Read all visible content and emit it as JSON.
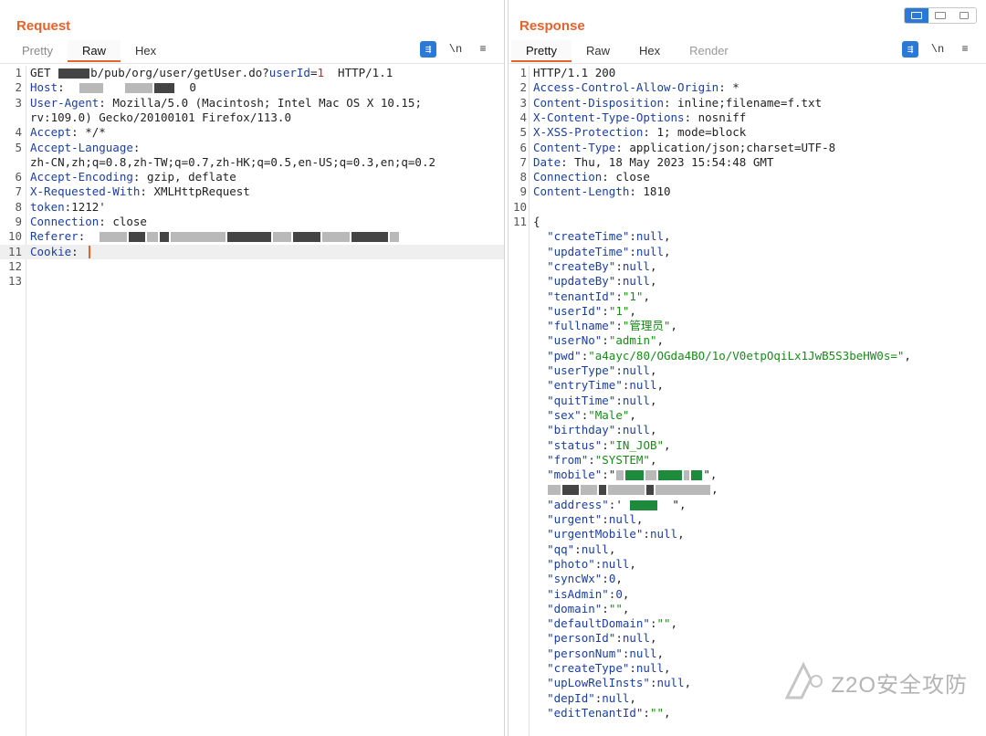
{
  "request": {
    "title": "Request",
    "tabs": [
      "Pretty",
      "Raw",
      "Hex"
    ],
    "active_tab": "Raw",
    "tools": {
      "wrap": "\\n",
      "menu": "≡"
    },
    "lines": [
      {
        "n": "1",
        "parts": [
          [
            "t",
            "GET "
          ],
          [
            "blurd",
            "34"
          ],
          [
            "t",
            "b/pub/org/user/getUser.do?"
          ],
          [
            "k",
            "userId"
          ],
          [
            "t",
            "="
          ],
          [
            "red",
            "1"
          ],
          [
            "t",
            "  HTTP/1.1"
          ]
        ]
      },
      {
        "n": "2",
        "parts": [
          [
            "k",
            "Host"
          ],
          [
            "t",
            ":  "
          ],
          [
            "blur",
            "26"
          ],
          [
            "t",
            "   "
          ],
          [
            "blur",
            "30"
          ],
          [
            "blurd",
            "22"
          ],
          [
            "t",
            "  0"
          ]
        ]
      },
      {
        "n": "3",
        "parts": [
          [
            "k",
            "User-Agent"
          ],
          [
            "t",
            ": Mozilla/5.0 (Macintosh; Intel Mac OS X 10.15;"
          ]
        ]
      },
      {
        "n": "",
        "parts": [
          [
            "t",
            "rv:109.0) Gecko/20100101 Firefox/113.0"
          ]
        ]
      },
      {
        "n": "4",
        "parts": [
          [
            "k",
            "Accept"
          ],
          [
            "t",
            ": */*"
          ]
        ]
      },
      {
        "n": "5",
        "parts": [
          [
            "k",
            "Accept-Language"
          ],
          [
            "t",
            ":"
          ]
        ]
      },
      {
        "n": "",
        "parts": [
          [
            "t",
            "zh-CN,zh;q=0.8,zh-TW;q=0.7,zh-HK;q=0.5,en-US;q=0.3,en;q=0.2"
          ]
        ]
      },
      {
        "n": "6",
        "parts": [
          [
            "k",
            "Accept-Encoding"
          ],
          [
            "t",
            ": gzip, deflate"
          ]
        ]
      },
      {
        "n": "7",
        "parts": [
          [
            "k",
            "X-Requested-With"
          ],
          [
            "t",
            ": XMLHttpRequest"
          ]
        ]
      },
      {
        "n": "8",
        "parts": [
          [
            "k",
            "token"
          ],
          [
            "t",
            ":1212'"
          ]
        ]
      },
      {
        "n": "9",
        "parts": [
          [
            "k",
            "Connection"
          ],
          [
            "t",
            ": close"
          ]
        ]
      },
      {
        "n": "10",
        "parts": [
          [
            "k",
            "Referer"
          ],
          [
            "t",
            ":  "
          ],
          [
            "blur",
            "30"
          ],
          [
            "blurd",
            "18"
          ],
          [
            "blur",
            "12"
          ],
          [
            "blurd",
            "10"
          ],
          [
            "blur",
            "60"
          ],
          [
            "blurd",
            "48"
          ],
          [
            "blur",
            "20"
          ],
          [
            "blurd",
            "30"
          ],
          [
            "blur",
            "30"
          ],
          [
            "blurd",
            "40"
          ],
          [
            "blur",
            "10"
          ]
        ]
      },
      {
        "n": "11",
        "parts": [
          [
            "k",
            "Cookie"
          ],
          [
            "t",
            ": "
          ],
          [
            "caret",
            ""
          ]
        ],
        "highlight": true
      },
      {
        "n": "12",
        "parts": []
      },
      {
        "n": "13",
        "parts": []
      }
    ]
  },
  "response": {
    "title": "Response",
    "tabs": [
      "Pretty",
      "Raw",
      "Hex",
      "Render"
    ],
    "active_tab": "Pretty",
    "tools": {
      "wrap": "\\n",
      "menu": "≡"
    },
    "lines": [
      {
        "n": "1",
        "parts": [
          [
            "t",
            "HTTP/1.1 200"
          ]
        ]
      },
      {
        "n": "2",
        "parts": [
          [
            "k",
            "Access-Control-Allow-Origin"
          ],
          [
            "t",
            ": *"
          ]
        ]
      },
      {
        "n": "3",
        "parts": [
          [
            "k",
            "Content-Disposition"
          ],
          [
            "t",
            ": inline;filename=f.txt"
          ]
        ]
      },
      {
        "n": "4",
        "parts": [
          [
            "k",
            "X-Content-Type-Options"
          ],
          [
            "t",
            ": nosniff"
          ]
        ]
      },
      {
        "n": "5",
        "parts": [
          [
            "k",
            "X-XSS-Protection"
          ],
          [
            "t",
            ": 1; mode=block"
          ]
        ]
      },
      {
        "n": "6",
        "parts": [
          [
            "k",
            "Content-Type"
          ],
          [
            "t",
            ": application/json;charset=UTF-8"
          ]
        ]
      },
      {
        "n": "7",
        "parts": [
          [
            "k",
            "Date"
          ],
          [
            "t",
            ": Thu, 18 May 2023 15:54:48 GMT"
          ]
        ]
      },
      {
        "n": "8",
        "parts": [
          [
            "k",
            "Connection"
          ],
          [
            "t",
            ": close"
          ]
        ]
      },
      {
        "n": "9",
        "parts": [
          [
            "k",
            "Content-Length"
          ],
          [
            "t",
            ": 1810"
          ]
        ]
      },
      {
        "n": "10",
        "parts": []
      },
      {
        "n": "11",
        "parts": [
          [
            "t",
            "{"
          ]
        ]
      },
      {
        "n": "",
        "parts": [
          [
            "t",
            "  "
          ],
          [
            "k",
            "\"createTime\""
          ],
          [
            "t",
            ":"
          ],
          [
            "v",
            "null"
          ],
          [
            "t",
            ","
          ]
        ]
      },
      {
        "n": "",
        "parts": [
          [
            "t",
            "  "
          ],
          [
            "k",
            "\"updateTime\""
          ],
          [
            "t",
            ":"
          ],
          [
            "v",
            "null"
          ],
          [
            "t",
            ","
          ]
        ]
      },
      {
        "n": "",
        "parts": [
          [
            "t",
            "  "
          ],
          [
            "k",
            "\"createBy\""
          ],
          [
            "t",
            ":"
          ],
          [
            "v",
            "null"
          ],
          [
            "t",
            ","
          ]
        ]
      },
      {
        "n": "",
        "parts": [
          [
            "t",
            "  "
          ],
          [
            "k",
            "\"updateBy\""
          ],
          [
            "t",
            ":"
          ],
          [
            "v",
            "null"
          ],
          [
            "t",
            ","
          ]
        ]
      },
      {
        "n": "",
        "parts": [
          [
            "t",
            "  "
          ],
          [
            "k",
            "\"tenantId\""
          ],
          [
            "t",
            ":"
          ],
          [
            "s",
            "\"1\""
          ],
          [
            "t",
            ","
          ]
        ]
      },
      {
        "n": "",
        "parts": [
          [
            "t",
            "  "
          ],
          [
            "k",
            "\"userId\""
          ],
          [
            "t",
            ":"
          ],
          [
            "s",
            "\"1\""
          ],
          [
            "t",
            ","
          ]
        ]
      },
      {
        "n": "",
        "parts": [
          [
            "t",
            "  "
          ],
          [
            "k",
            "\"fullname\""
          ],
          [
            "t",
            ":"
          ],
          [
            "s",
            "\"管理员\""
          ],
          [
            "t",
            ","
          ]
        ]
      },
      {
        "n": "",
        "parts": [
          [
            "t",
            "  "
          ],
          [
            "k",
            "\"userNo\""
          ],
          [
            "t",
            ":"
          ],
          [
            "s",
            "\"admin\""
          ],
          [
            "t",
            ","
          ]
        ]
      },
      {
        "n": "",
        "parts": [
          [
            "t",
            "  "
          ],
          [
            "k",
            "\"pwd\""
          ],
          [
            "t",
            ":"
          ],
          [
            "s",
            "\"a4ayc/80/OGda4BO/1o/V0etpOqiLx1JwB5S3beHW0s=\""
          ],
          [
            "t",
            ","
          ]
        ]
      },
      {
        "n": "",
        "parts": [
          [
            "t",
            "  "
          ],
          [
            "k",
            "\"userType\""
          ],
          [
            "t",
            ":"
          ],
          [
            "v",
            "null"
          ],
          [
            "t",
            ","
          ]
        ]
      },
      {
        "n": "",
        "parts": [
          [
            "t",
            "  "
          ],
          [
            "k",
            "\"entryTime\""
          ],
          [
            "t",
            ":"
          ],
          [
            "v",
            "null"
          ],
          [
            "t",
            ","
          ]
        ]
      },
      {
        "n": "",
        "parts": [
          [
            "t",
            "  "
          ],
          [
            "k",
            "\"quitTime\""
          ],
          [
            "t",
            ":"
          ],
          [
            "v",
            "null"
          ],
          [
            "t",
            ","
          ]
        ]
      },
      {
        "n": "",
        "parts": [
          [
            "t",
            "  "
          ],
          [
            "k",
            "\"sex\""
          ],
          [
            "t",
            ":"
          ],
          [
            "s",
            "\"Male\""
          ],
          [
            "t",
            ","
          ]
        ]
      },
      {
        "n": "",
        "parts": [
          [
            "t",
            "  "
          ],
          [
            "k",
            "\"birthday\""
          ],
          [
            "t",
            ":"
          ],
          [
            "v",
            "null"
          ],
          [
            "t",
            ","
          ]
        ]
      },
      {
        "n": "",
        "parts": [
          [
            "t",
            "  "
          ],
          [
            "k",
            "\"status\""
          ],
          [
            "t",
            ":"
          ],
          [
            "s",
            "\"IN_JOB\""
          ],
          [
            "t",
            ","
          ]
        ]
      },
      {
        "n": "",
        "parts": [
          [
            "t",
            "  "
          ],
          [
            "k",
            "\"from\""
          ],
          [
            "t",
            ":"
          ],
          [
            "s",
            "\"SYSTEM\""
          ],
          [
            "t",
            ","
          ]
        ]
      },
      {
        "n": "",
        "parts": [
          [
            "t",
            "  "
          ],
          [
            "k",
            "\"mobile\""
          ],
          [
            "t",
            ":\""
          ],
          [
            "blur",
            "8"
          ],
          [
            "blurg",
            "20"
          ],
          [
            "blur",
            "12"
          ],
          [
            "blurg",
            "26"
          ],
          [
            "blur",
            "6"
          ],
          [
            "blurg",
            "12"
          ],
          [
            "t",
            "\","
          ]
        ]
      },
      {
        "n": "",
        "parts": [
          [
            "t",
            "  "
          ],
          [
            "blur",
            "14"
          ],
          [
            "blurd",
            "18"
          ],
          [
            "blur",
            "18"
          ],
          [
            "blurd",
            "8"
          ],
          [
            "blur",
            "40"
          ],
          [
            "blurd",
            "8"
          ],
          [
            "blur",
            "60"
          ],
          [
            "t",
            ","
          ]
        ]
      },
      {
        "n": "",
        "parts": [
          [
            "t",
            "  "
          ],
          [
            "k",
            "\"address\""
          ],
          [
            "t",
            ":' "
          ],
          [
            "blurg",
            "30"
          ],
          [
            "t",
            "  \","
          ]
        ]
      },
      {
        "n": "",
        "parts": [
          [
            "t",
            "  "
          ],
          [
            "k",
            "\"urgent\""
          ],
          [
            "t",
            ":"
          ],
          [
            "v",
            "null"
          ],
          [
            "t",
            ","
          ]
        ]
      },
      {
        "n": "",
        "parts": [
          [
            "t",
            "  "
          ],
          [
            "k",
            "\"urgentMobile\""
          ],
          [
            "t",
            ":"
          ],
          [
            "v",
            "null"
          ],
          [
            "t",
            ","
          ]
        ]
      },
      {
        "n": "",
        "parts": [
          [
            "t",
            "  "
          ],
          [
            "k",
            "\"qq\""
          ],
          [
            "t",
            ":"
          ],
          [
            "v",
            "null"
          ],
          [
            "t",
            ","
          ]
        ]
      },
      {
        "n": "",
        "parts": [
          [
            "t",
            "  "
          ],
          [
            "k",
            "\"photo\""
          ],
          [
            "t",
            ":"
          ],
          [
            "v",
            "null"
          ],
          [
            "t",
            ","
          ]
        ]
      },
      {
        "n": "",
        "parts": [
          [
            "t",
            "  "
          ],
          [
            "k",
            "\"syncWx\""
          ],
          [
            "t",
            ":"
          ],
          [
            "v",
            "0"
          ],
          [
            "t",
            ","
          ]
        ]
      },
      {
        "n": "",
        "parts": [
          [
            "t",
            "  "
          ],
          [
            "k",
            "\"isAdmin\""
          ],
          [
            "t",
            ":"
          ],
          [
            "v",
            "0"
          ],
          [
            "t",
            ","
          ]
        ]
      },
      {
        "n": "",
        "parts": [
          [
            "t",
            "  "
          ],
          [
            "k",
            "\"domain\""
          ],
          [
            "t",
            ":"
          ],
          [
            "s",
            "\"\""
          ],
          [
            "t",
            ","
          ]
        ]
      },
      {
        "n": "",
        "parts": [
          [
            "t",
            "  "
          ],
          [
            "k",
            "\"defaultDomain\""
          ],
          [
            "t",
            ":"
          ],
          [
            "s",
            "\"\""
          ],
          [
            "t",
            ","
          ]
        ]
      },
      {
        "n": "",
        "parts": [
          [
            "t",
            "  "
          ],
          [
            "k",
            "\"personId\""
          ],
          [
            "t",
            ":"
          ],
          [
            "v",
            "null"
          ],
          [
            "t",
            ","
          ]
        ]
      },
      {
        "n": "",
        "parts": [
          [
            "t",
            "  "
          ],
          [
            "k",
            "\"personNum\""
          ],
          [
            "t",
            ":"
          ],
          [
            "v",
            "null"
          ],
          [
            "t",
            ","
          ]
        ]
      },
      {
        "n": "",
        "parts": [
          [
            "t",
            "  "
          ],
          [
            "k",
            "\"createType\""
          ],
          [
            "t",
            ":"
          ],
          [
            "v",
            "null"
          ],
          [
            "t",
            ","
          ]
        ]
      },
      {
        "n": "",
        "parts": [
          [
            "t",
            "  "
          ],
          [
            "k",
            "\"upLowRelInsts\""
          ],
          [
            "t",
            ":"
          ],
          [
            "v",
            "null"
          ],
          [
            "t",
            ","
          ]
        ]
      },
      {
        "n": "",
        "parts": [
          [
            "t",
            "  "
          ],
          [
            "k",
            "\"depId\""
          ],
          [
            "t",
            ":"
          ],
          [
            "v",
            "null"
          ],
          [
            "t",
            ","
          ]
        ]
      },
      {
        "n": "",
        "parts": [
          [
            "t",
            "  "
          ],
          [
            "k",
            "\"editTenantId\""
          ],
          [
            "t",
            ":"
          ],
          [
            "s",
            "\"\""
          ],
          [
            "t",
            ","
          ]
        ]
      }
    ]
  },
  "watermark": {
    "text": "Z2O安全攻防"
  },
  "colors": {
    "accent": "#e8622c",
    "key": "#1b3fa0",
    "string": "#1a8a1a",
    "button_blue": "#2a79d6"
  }
}
